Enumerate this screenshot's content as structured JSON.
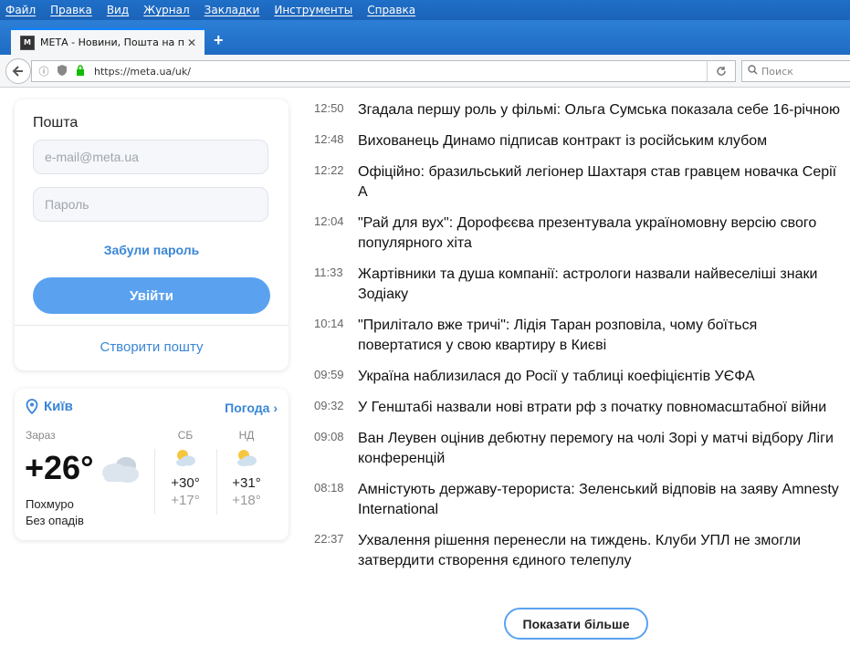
{
  "menu": [
    "Файл",
    "Правка",
    "Вид",
    "Журнал",
    "Закладки",
    "Инструменты",
    "Справка"
  ],
  "tab": {
    "favicon": "M",
    "title": "МЕТА - Новини, Пошта на п...",
    "close": "✕",
    "new_tab": "+"
  },
  "navbar": {
    "url": "https://meta.ua/uk/",
    "search_placeholder": "Поиск"
  },
  "mail": {
    "title": "Пошта",
    "email_placeholder": "e-mail@meta.ua",
    "password_placeholder": "Пароль",
    "forgot": "Забули пароль",
    "login": "Увійти",
    "create": "Створити пошту"
  },
  "weather": {
    "city": "Київ",
    "more": "Погода",
    "now_label": "Зараз",
    "temp": "+26°",
    "desc1": "Похмуро",
    "desc2": "Без опадів",
    "days": [
      {
        "name": "СБ",
        "hi": "+30°",
        "lo": "+17°"
      },
      {
        "name": "НД",
        "hi": "+31°",
        "lo": "+18°"
      }
    ]
  },
  "news": [
    {
      "time": "12:50",
      "text": "Згадала першу роль у фільмі: Ольга Сумська показала себе 16-річною"
    },
    {
      "time": "12:48",
      "text": "Вихованець Динамо підписав контракт із російським клубом"
    },
    {
      "time": "12:22",
      "text": "Офіційно: бразильський легіонер Шахтаря став гравцем новачка Серії А"
    },
    {
      "time": "12:04",
      "text": "\"Рай для вух\": Дорофєєва презентувала україномовну версію свого популярного хіта"
    },
    {
      "time": "11:33",
      "text": "Жартівники та душа компанії: астрологи назвали найвеселіші знаки Зодіаку"
    },
    {
      "time": "10:14",
      "text": "\"Прилітало вже тричі\": Лідія Таран розповіла, чому боїться повертатися у свою квартиру в Києві"
    },
    {
      "time": "09:59",
      "text": "Україна наблизилася до Росії у таблиці коефіцієнтів УЄФА"
    },
    {
      "time": "09:32",
      "text": "У Генштабі назвали нові втрати рф з початку повномасштабної війни"
    },
    {
      "time": "09:08",
      "text": "Ван Леувен оцінив дебютну перемогу на чолі Зорі у матчі відбору Ліги конференцій"
    },
    {
      "time": "08:18",
      "text": "Амністують державу-терориста: Зеленський відповів на заяву Amnesty International"
    },
    {
      "time": "22:37",
      "text": "Ухвалення рішення перенесли на тиждень. Клуби УПЛ не змогли затвердити створення єдиного телепулу"
    }
  ],
  "show_more": "Показати більше"
}
